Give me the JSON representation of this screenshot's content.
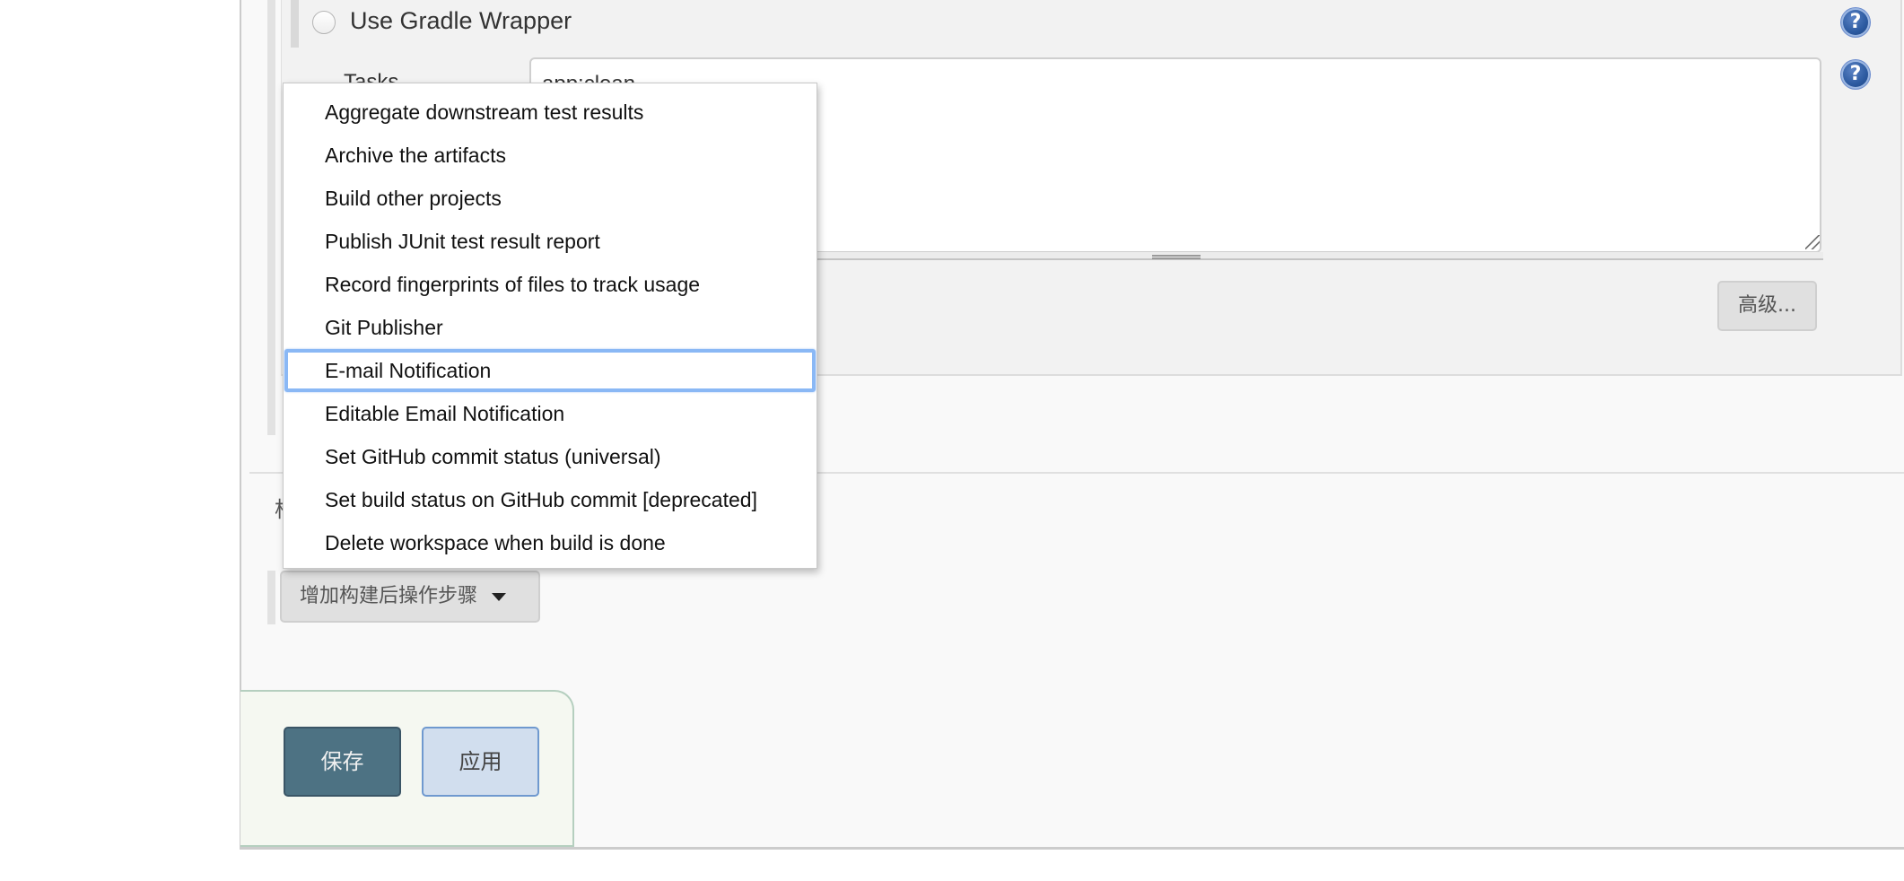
{
  "gradle_section": {
    "use_gradle_wrapper_label": "Use Gradle Wrapper",
    "use_gradle_wrapper_selected": false,
    "tasks_label": "Tasks",
    "tasks_value": "app:clean",
    "advanced_button_label": "高级...",
    "help_icon_glyph": "?"
  },
  "post_build": {
    "partially_hidden_label": "构",
    "add_step_button_label": "增加构建后操作步骤",
    "menu": {
      "items": [
        {
          "label": "Aggregate downstream test results"
        },
        {
          "label": "Archive the artifacts"
        },
        {
          "label": "Build other projects"
        },
        {
          "label": "Publish JUnit test result report"
        },
        {
          "label": "Record fingerprints of files to track usage"
        },
        {
          "label": "Git Publisher"
        },
        {
          "label": "E-mail Notification"
        },
        {
          "label": "Editable Email Notification"
        },
        {
          "label": "Set GitHub commit status (universal)"
        },
        {
          "label": "Set build status on GitHub commit [deprecated]"
        },
        {
          "label": "Delete workspace when build is done"
        }
      ],
      "highlighted_index": 6
    }
  },
  "actions": {
    "save_label": "保存",
    "apply_label": "应用"
  },
  "colors": {
    "save_button": "#4d7283",
    "apply_button": "#d1deee",
    "focus_ring": "#8ab8f5",
    "help_icon": "#2c5aa0"
  }
}
